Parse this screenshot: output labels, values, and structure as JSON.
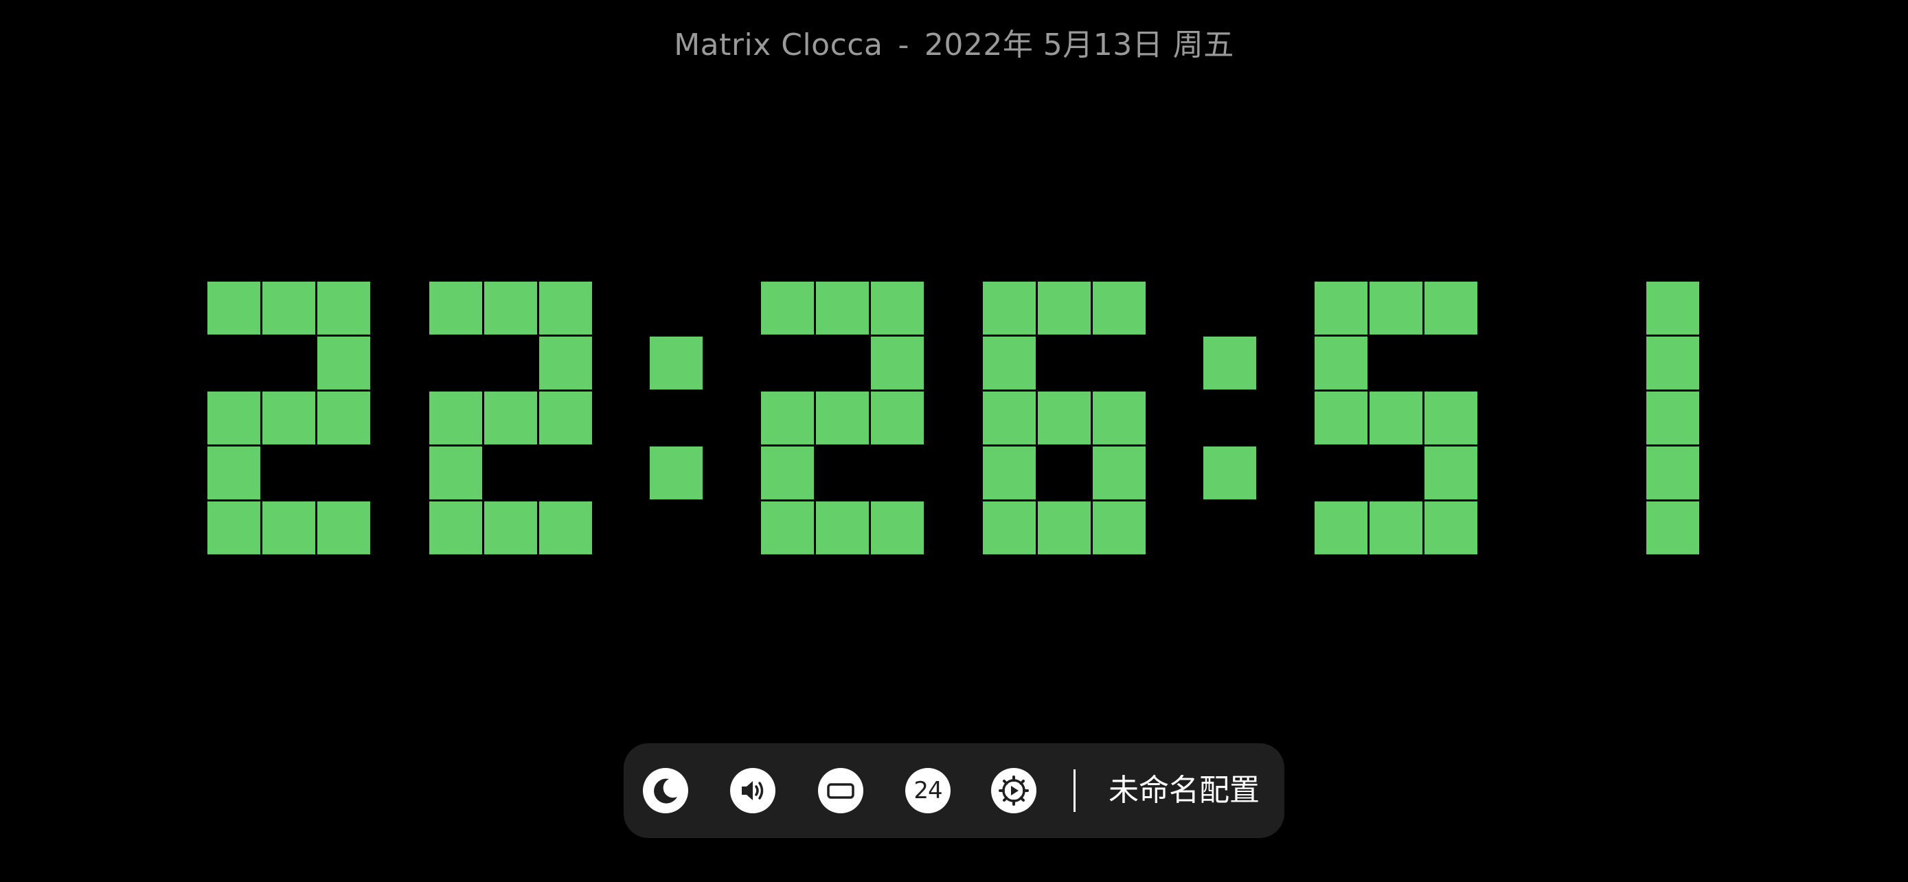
{
  "header": {
    "app_name": "Matrix Clocca",
    "separator": "-",
    "date": "2022年 5月13日 周五"
  },
  "clock": {
    "time": "22:26:51",
    "hours": "22",
    "minutes": "26",
    "seconds": "51",
    "format": "24h",
    "cell_color": "#65cf6a",
    "background_color": "#000000"
  },
  "toolbar": {
    "buttons": [
      {
        "name": "night-mode-button",
        "icon": "moon-icon"
      },
      {
        "name": "sound-button",
        "icon": "speaker-icon"
      },
      {
        "name": "display-button",
        "icon": "landscape-rect-icon"
      },
      {
        "name": "hour-format-button",
        "icon": "clock-24-icon",
        "label": "24"
      },
      {
        "name": "settings-button",
        "icon": "gear-play-icon"
      }
    ],
    "profile_name": "未命名配置",
    "background_color": "#1f1f1f"
  }
}
